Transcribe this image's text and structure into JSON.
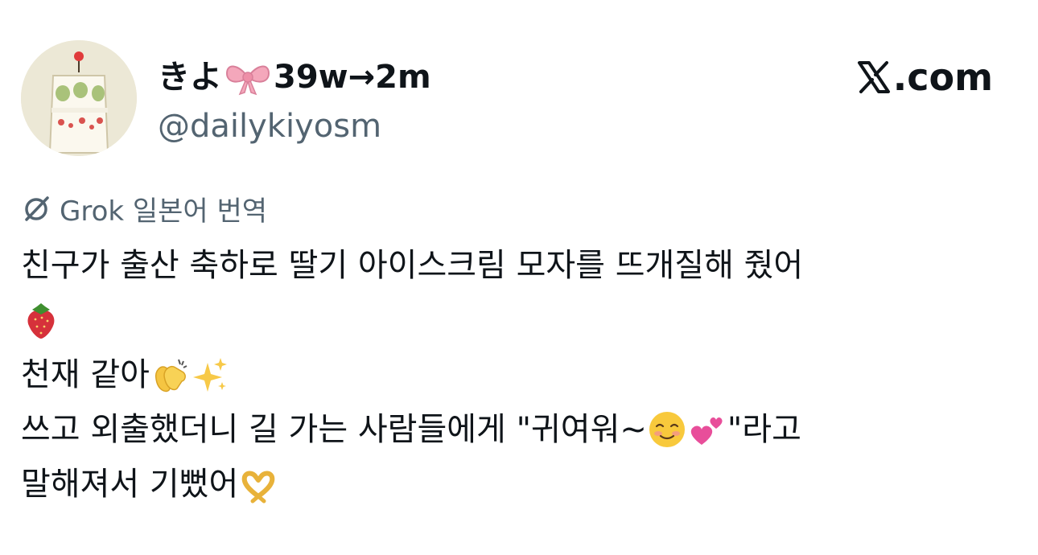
{
  "post": {
    "author": {
      "name_prefix": "きよ",
      "name_suffix": "39w→2m",
      "handle": "@dailykiyosm",
      "name_emoji": "ribbon-icon"
    },
    "brand": {
      "label": ".com",
      "logo": "x-logo-icon"
    },
    "translation": {
      "icon": "grok-icon",
      "label": "Grok 일본어 번역"
    },
    "body": {
      "line1": "친구가 출산 축하로 딸기 아이스크림 모자를 뜨개질해 줬어",
      "line2_emoji": "strawberry-icon",
      "line3": "천재 같아",
      "line3_emojis": [
        "clapping-hands-icon",
        "sparkles-icon"
      ],
      "line4_part1": "쓰고 외출했더니 길 가는 사람들에게 \"귀여워~",
      "line4_emojis": [
        "smiling-face-icon",
        "two-hearts-icon"
      ],
      "line4_part2": "\"라고",
      "line5": "말해져서 기뻤어",
      "line5_emoji": "heart-hands-icon"
    },
    "colors": {
      "text": "#0f1419",
      "secondary_text": "#536471",
      "background": "#ffffff"
    }
  }
}
